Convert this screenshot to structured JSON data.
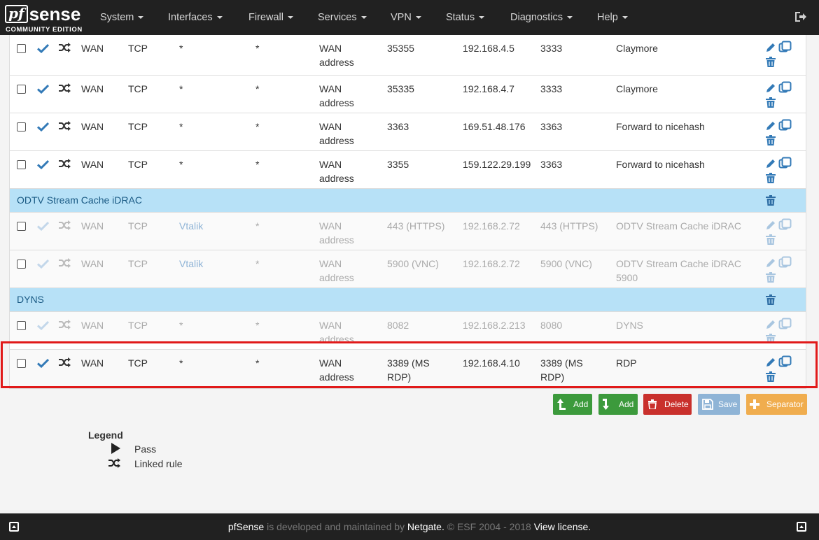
{
  "brand": {
    "logo_pf": "pf",
    "logo_sense": "sense",
    "edition": "COMMUNITY EDITION"
  },
  "nav": [
    "System",
    "Interfaces",
    "Firewall",
    "Services",
    "VPN",
    "Status",
    "Diagnostics",
    "Help"
  ],
  "rules": [
    {
      "enabled": true,
      "interface": "WAN",
      "protocol": "TCP",
      "source": "*",
      "source_port": "*",
      "dest_line1": "WAN",
      "dest_line2": "address",
      "dest_ports": "35355",
      "nat_ip": "192.168.4.5",
      "nat_ports": "3333",
      "description": "Claymore",
      "highlighted": false
    },
    {
      "enabled": true,
      "interface": "WAN",
      "protocol": "TCP",
      "source": "*",
      "source_port": "*",
      "dest_line1": "WAN",
      "dest_line2": "address",
      "dest_ports": "35335",
      "nat_ip": "192.168.4.7",
      "nat_ports": "3333",
      "description": "Claymore",
      "highlighted": false
    },
    {
      "enabled": true,
      "interface": "WAN",
      "protocol": "TCP",
      "source": "*",
      "source_port": "*",
      "dest_line1": "WAN",
      "dest_line2": "address",
      "dest_ports": "3363",
      "nat_ip": "169.51.48.176",
      "nat_ports": "3363",
      "description": "Forward to nicehash",
      "highlighted": false
    },
    {
      "enabled": true,
      "interface": "WAN",
      "protocol": "TCP",
      "source": "*",
      "source_port": "*",
      "dest_line1": "WAN",
      "dest_line2": "address",
      "dest_ports": "3355",
      "nat_ip": "159.122.29.199",
      "nat_ports": "3363",
      "description": "Forward to nicehash",
      "highlighted": false
    },
    {
      "separator": "ODTV Stream Cache iDRAC"
    },
    {
      "enabled": false,
      "interface": "WAN",
      "protocol": "TCP",
      "source": "Vtalik",
      "source_port": "*",
      "dest_line1": "WAN",
      "dest_line2": "address",
      "dest_ports": "443 (HTTPS)",
      "nat_ip": "192.168.2.72",
      "nat_ports": "443 (HTTPS)",
      "description": "ODTV Stream Cache iDRAC",
      "highlighted": false
    },
    {
      "enabled": false,
      "interface": "WAN",
      "protocol": "TCP",
      "source": "Vtalik",
      "source_port": "*",
      "dest_line1": "WAN",
      "dest_line2": "address",
      "dest_ports": "5900 (VNC)",
      "nat_ip": "192.168.2.72",
      "nat_ports": "5900 (VNC)",
      "description": "ODTV Stream Cache iDRAC",
      "description_line2": "5900",
      "highlighted": false
    },
    {
      "separator": "DYNS"
    },
    {
      "enabled": false,
      "interface": "WAN",
      "protocol": "TCP",
      "source": "*",
      "source_port": "*",
      "dest_line1": "WAN",
      "dest_line2": "address",
      "dest_ports": "8082",
      "nat_ip": "192.168.2.213",
      "nat_ports": "8080",
      "description": "DYNS",
      "highlighted": false
    },
    {
      "enabled": true,
      "interface": "WAN",
      "protocol": "TCP",
      "source": "*",
      "source_port": "*",
      "dest_line1": "WAN",
      "dest_line2": "address",
      "dest_ports": "3389 (MS",
      "dest_ports_line2": "RDP)",
      "nat_ip": "192.168.4.10",
      "nat_ports": "3389 (MS",
      "nat_ports_line2": "RDP)",
      "description": "RDP",
      "highlighted": true
    }
  ],
  "buttons": [
    {
      "label": "Add",
      "color": "#3c9a3c",
      "icon": "arrow-up-icon"
    },
    {
      "label": "Add",
      "color": "#3c9a3c",
      "icon": "arrow-down-icon"
    },
    {
      "label": "Delete",
      "color": "#c9302c",
      "icon": "trash-icon"
    },
    {
      "label": "Save",
      "color": "#8fb4d6",
      "icon": "save-icon"
    },
    {
      "label": "Separator",
      "color": "#f0ad4e",
      "icon": "plus-icon"
    }
  ],
  "legend": {
    "title": "Legend",
    "items": [
      "Pass",
      "Linked rule"
    ]
  },
  "footer": {
    "brand": "pfSense",
    "middle": "is developed and maintained by",
    "company": "Netgate.",
    "copyright": "© ESF 2004 - 2018",
    "license": "View license."
  },
  "colors": {
    "navbar": "#212121",
    "separator": "#b7e1f7",
    "link": "#337ab7",
    "check": "#337ab7",
    "highlight_border": "#e11a1a"
  }
}
